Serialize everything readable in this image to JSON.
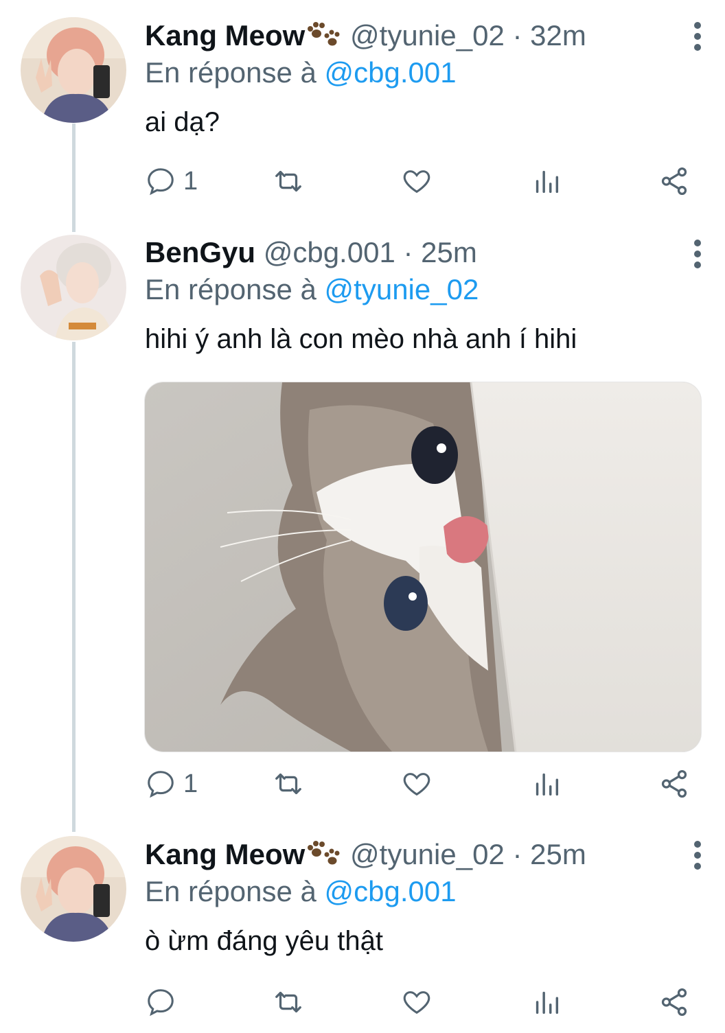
{
  "tweets": [
    {
      "display_name": "Kang Meow",
      "name_emoji": "paw-prints-icon",
      "handle": "@tyunie_02",
      "separator": "·",
      "time": "32m",
      "reply_prefix": "En réponse à",
      "reply_to": "@cbg.001",
      "text": "ai dạ?",
      "reply_count": "1",
      "avatar": "avatar-kang-meow"
    },
    {
      "display_name": "BenGyu",
      "handle": "@cbg.001",
      "separator": "·",
      "time": "25m",
      "reply_prefix": "En réponse à",
      "reply_to": "@tyunie_02",
      "text": "hihi ý anh là con mèo nhà anh í hihi",
      "media": "cat-peeking-photo",
      "reply_count": "1",
      "avatar": "avatar-bengyu"
    },
    {
      "display_name": "Kang Meow",
      "name_emoji": "paw-prints-icon",
      "handle": "@tyunie_02",
      "separator": "·",
      "time": "25m",
      "reply_prefix": "En réponse à",
      "reply_to": "@cbg.001",
      "text": "ò ừm đáng yêu thật",
      "reply_count": "",
      "avatar": "avatar-kang-meow"
    }
  ],
  "icons": {
    "reply": "reply-icon",
    "retweet": "retweet-icon",
    "like": "heart-icon",
    "analytics": "analytics-icon",
    "share": "share-icon",
    "more": "more-vertical-icon"
  },
  "colors": {
    "text": "#0f1419",
    "secondary": "#536471",
    "link": "#1d9bf0",
    "thread_line": "#cfd9de"
  }
}
